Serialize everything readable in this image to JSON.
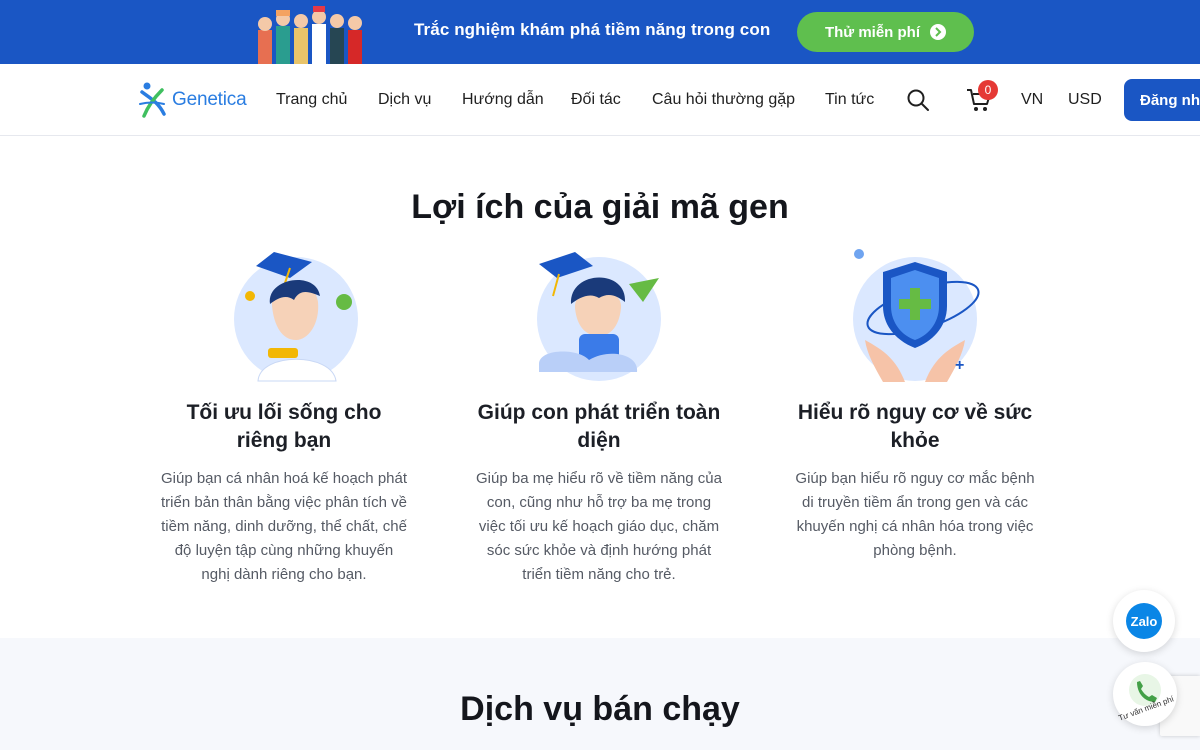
{
  "promo": {
    "text": "Trắc nghiệm khám phá tiềm năng trong con",
    "button_label": "Thử miễn phí"
  },
  "header": {
    "logo_text": "Genetica",
    "nav": [
      "Trang chủ",
      "Dịch vụ",
      "Hướng dẫn",
      "Đối tác",
      "Câu hỏi thường gặp",
      "Tin tức"
    ],
    "cart_count": "0",
    "language": "VN",
    "currency": "USD",
    "signup_label": "Đăng nhập"
  },
  "benefits": {
    "title": "Lợi ích của giải mã gen",
    "items": [
      {
        "icon": "graduate-adult-icon",
        "title": "Tối ưu lối sống cho riêng bạn",
        "desc": "Giúp bạn cá nhân hoá kế hoạch phát triển bản thân bằng việc phân tích về tiềm năng, dinh dưỡng, thể chất, chế độ luyện tập cùng những khuyến nghị dành riêng cho bạn."
      },
      {
        "icon": "child-growth-icon",
        "title": "Giúp con phát triển toàn diện",
        "desc": "Giúp ba mẹ hiểu rõ về tiềm năng của con, cũng như hỗ trợ ba mẹ trong việc tối ưu kế hoạch giáo dục, chăm sóc sức khỏe và định hướng phát triển tiềm năng cho trẻ."
      },
      {
        "icon": "health-shield-icon",
        "title": "Hiểu rõ nguy cơ về sức khỏe",
        "desc": "Giúp bạn hiểu rõ nguy cơ mắc bệnh di truyền tiềm ẩn trong gen và các khuyến nghị cá nhân hóa trong việc phòng bệnh."
      }
    ]
  },
  "bestseller": {
    "title": "Dịch vụ bán chạy"
  },
  "floating": {
    "zalo_label": "Zalo",
    "call_label": "Tư vấn miễn phí"
  },
  "colors": {
    "brand_blue": "#1a56c4",
    "accent_green": "#5fbf4e",
    "badge_red": "#e53935"
  }
}
